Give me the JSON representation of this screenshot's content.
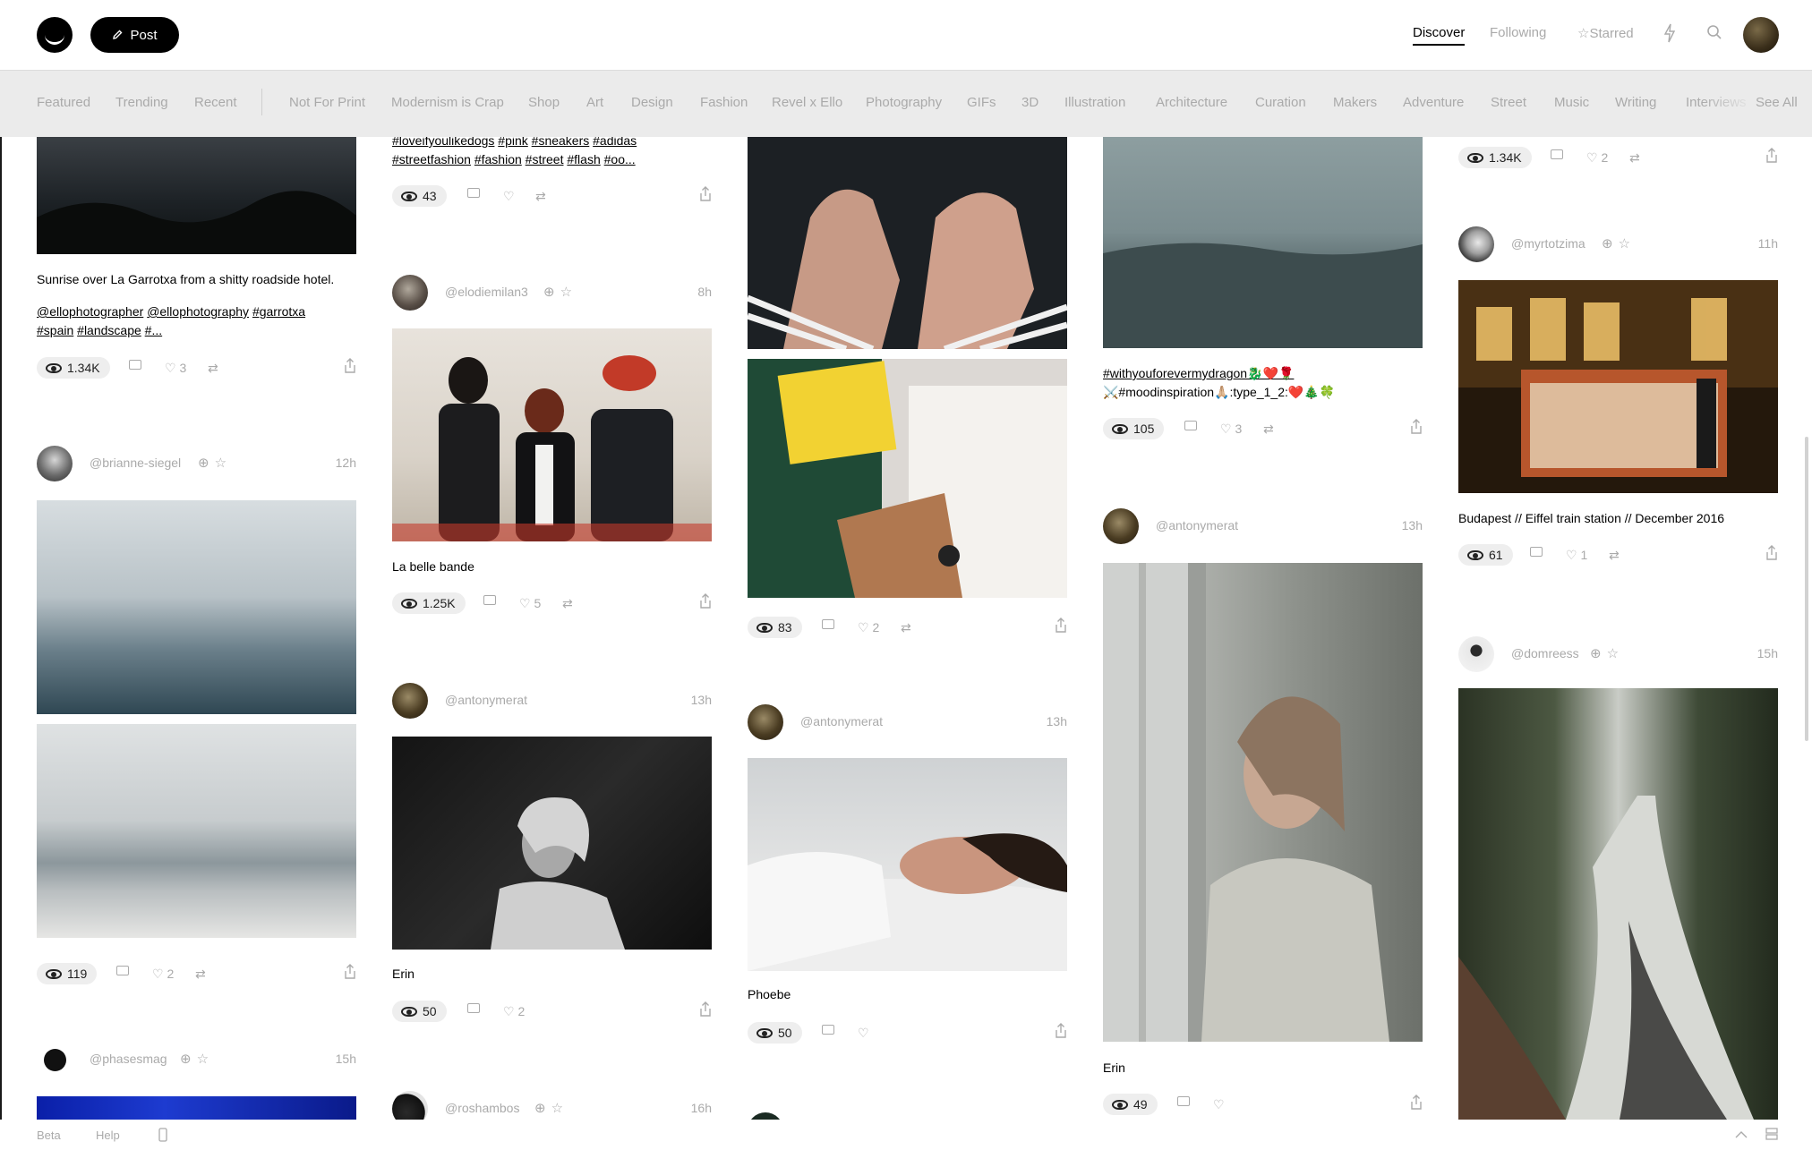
{
  "header": {
    "post_label": "Post",
    "nav": {
      "discover": "Discover",
      "following": "Following",
      "starred": "Starred"
    }
  },
  "categories": [
    "Featured",
    "Trending",
    "Recent",
    "Not For Print",
    "Modernism is Crap",
    "Shop",
    "Art",
    "Design",
    "Fashion",
    "Revel x Ello",
    "Photography",
    "GIFs",
    "3D",
    "Illustration",
    "Architecture",
    "Curation",
    "Makers",
    "Adventure",
    "Street",
    "Music",
    "Writing",
    "Interviews"
  ],
  "see_all": "See All",
  "columns": {
    "c1": {
      "p1": {
        "caption": "Sunrise over La Garrotxa from a shitty roadside hotel.",
        "tags_line1": [
          "@ellophotographer",
          "@ellophotography",
          "#garrotxa"
        ],
        "tags_line2": [
          "#spain",
          "#landscape",
          "#..."
        ],
        "views": "1.34K",
        "likes": "3"
      },
      "p2": {
        "user": "@brianne-siegel",
        "time": "12h",
        "views": "119",
        "likes": "2"
      },
      "p3": {
        "user": "@phasesmag",
        "time": "15h"
      }
    },
    "c2": {
      "p1": {
        "tags_line1": [
          "#loveifyoulikedogs",
          "#pink",
          "#sneakers",
          "#adidas"
        ],
        "tags_line2": [
          "#streetfashion",
          "#fashion",
          "#street",
          "#flash",
          "#oo..."
        ],
        "views": "43"
      },
      "p2": {
        "user": "@elodiemilan3",
        "time": "8h",
        "caption": "La belle bande",
        "views": "1.25K",
        "likes": "5"
      },
      "p3": {
        "user": "@antonymerat",
        "time": "13h",
        "caption": "Erin",
        "views": "50",
        "likes": "2"
      },
      "p4": {
        "user": "@roshambos",
        "time": "16h"
      }
    },
    "c3": {
      "p1": {
        "views": "83",
        "likes": "2"
      },
      "p2": {
        "user": "@antonymerat",
        "time": "13h",
        "caption": "Phoebe",
        "views": "50"
      }
    },
    "c4": {
      "p1": {
        "tags_line1": "#withyouforevermydragon🐉❤️🌹",
        "tags_line2": "⚔️#moodinspiration🙏🏼:type_1_2:❤️🎄🍀",
        "views": "105",
        "likes": "3"
      },
      "p2": {
        "user": "@antonymerat",
        "time": "13h",
        "caption": "Erin",
        "views": "49"
      }
    },
    "c5": {
      "p1": {
        "views": "1.34K",
        "likes": "2"
      },
      "p2": {
        "user": "@myrtotzima",
        "time": "11h",
        "caption": "Budapest // Eiffel train station // December 2016",
        "views": "61",
        "likes": "1"
      },
      "p3": {
        "user": "@domreess",
        "time": "15h"
      }
    }
  },
  "footer": {
    "beta": "Beta",
    "help": "Help"
  }
}
